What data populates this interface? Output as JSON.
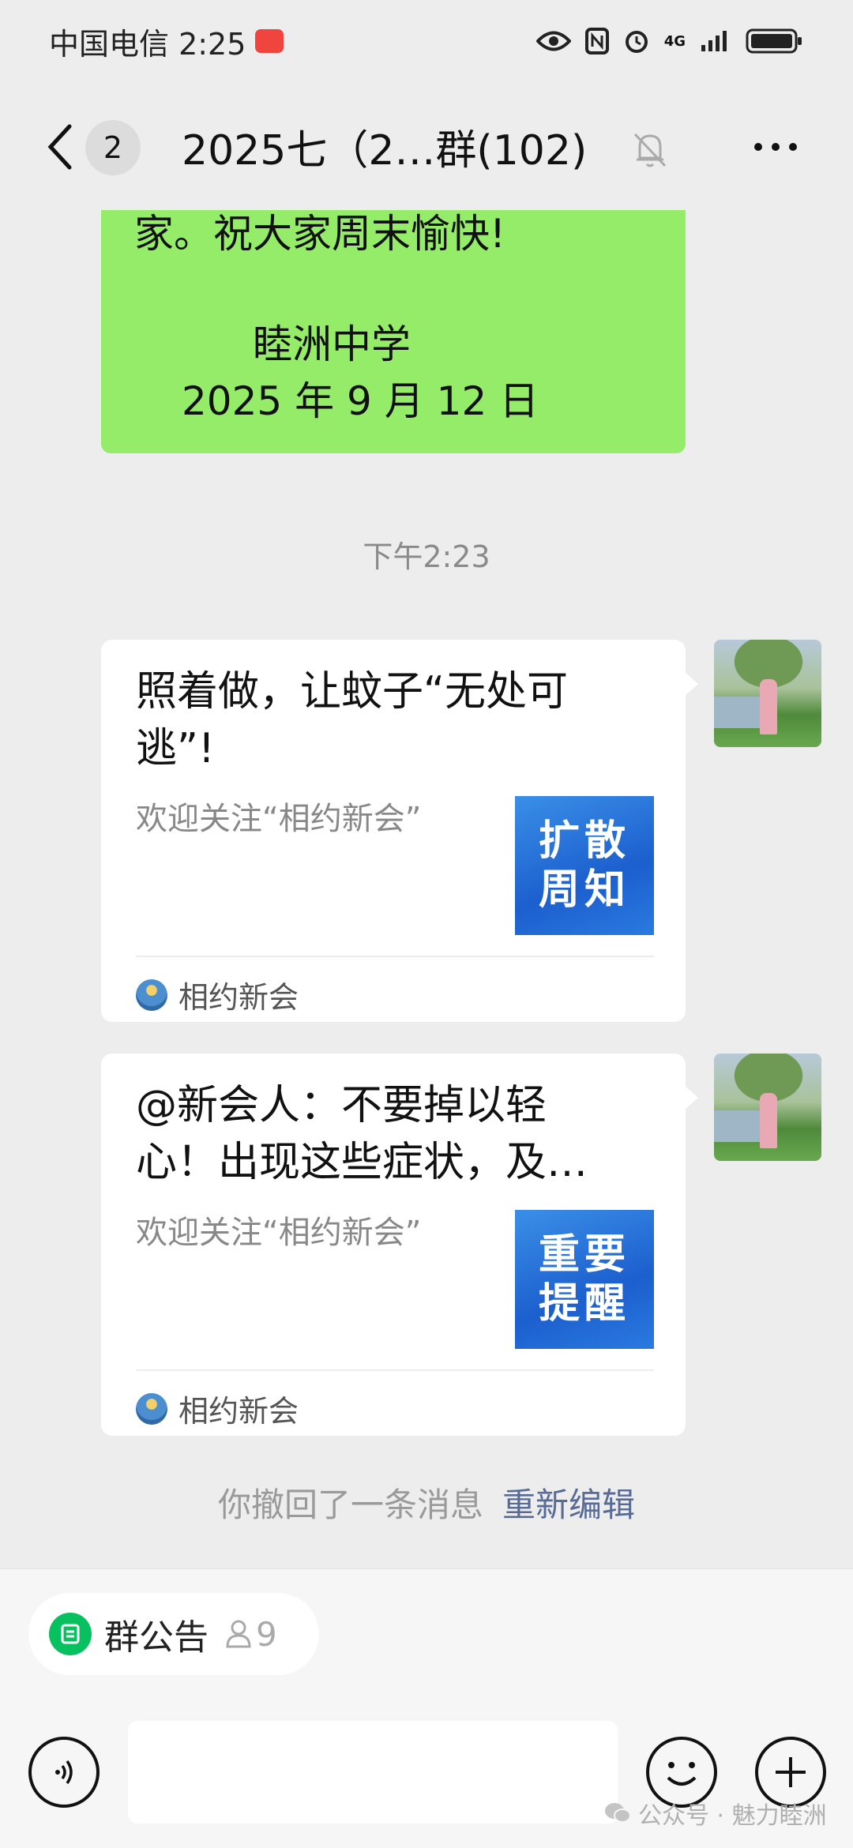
{
  "status_bar": {
    "carrier_time": "中国电信 2:25",
    "network": "4G"
  },
  "header": {
    "back_count": "2",
    "title": "2025七（2…群(102)"
  },
  "green_message": {
    "line1": "家。祝大家周末愉快!",
    "line2": "睦洲中学",
    "line3": "2025 年 9 月 12 日"
  },
  "time_divider": "下午2:23",
  "cards": [
    {
      "title": "照着做，让蚊子“无处可逃”!",
      "desc": "欢迎关注“相约新会”",
      "thumb": "扩散周知",
      "source": "相约新会"
    },
    {
      "title": "@新会人：不要掉以轻心！出现这些症状，及…",
      "desc": "欢迎关注“相约新会”",
      "thumb": "重要提醒",
      "source": "相约新会"
    }
  ],
  "recall": {
    "text": "你撤回了一条消息",
    "reedit": "重新编辑"
  },
  "bottom": {
    "notice_label": "群公告",
    "notice_count": "9"
  },
  "watermark": "公众号 · 魅力睦洲",
  "colors": {
    "bubble_green": "#95ec69",
    "link_blue": "#576b95",
    "wechat_green": "#07c160"
  }
}
